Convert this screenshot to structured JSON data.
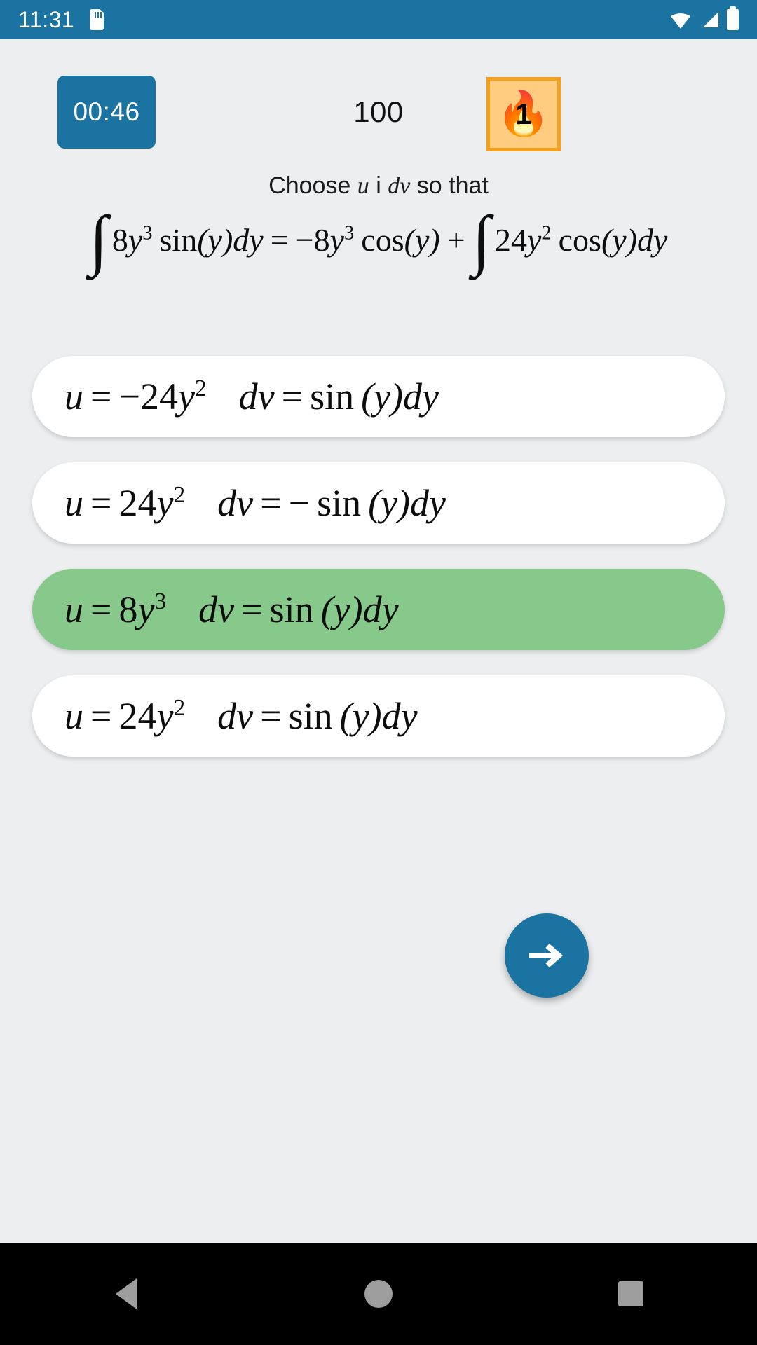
{
  "status_bar": {
    "time": "11:31",
    "icons": [
      "sd-card-icon",
      "wifi-icon",
      "cellular-signal-icon",
      "battery-icon"
    ],
    "background_color": "#1a73a0"
  },
  "header": {
    "timer": {
      "value": "00:46",
      "background_color": "#1a73a0",
      "text_color": "#ffffff"
    },
    "score": "100",
    "streak": {
      "count": "1",
      "icon": "flame-icon",
      "glyph": "🔥",
      "border_color": "#f5a11c",
      "fill_color": "#ffcc80"
    }
  },
  "question": {
    "prompt_prefix": "Choose ",
    "prompt_var_u": "u",
    "prompt_conj": " i ",
    "prompt_var_dv": "dv",
    "prompt_suffix": " so that",
    "equation": {
      "lhs_integrand_coef": "8",
      "lhs_var": "y",
      "lhs_exp": "3",
      "lhs_trig": "sin",
      "lhs_arg": "(y)",
      "lhs_diff": "dy",
      "equals": "=",
      "rhs_term_sign": "−",
      "rhs_term_coef": "8",
      "rhs_term_var": "y",
      "rhs_term_exp": "3",
      "rhs_trig": "cos",
      "rhs_arg": "(y)",
      "plus": "+",
      "rhs_int_coef": "24",
      "rhs_int_var": "y",
      "rhs_int_exp": "2",
      "rhs_int_trig": "cos",
      "rhs_int_arg": "(y)",
      "rhs_int_diff": "dy",
      "integral_symbol": "∫",
      "plain_text": "∫ 8y³ sin (y)dy = −8y³ cos (y) + ∫ 24y² cos (y)dy"
    }
  },
  "options": [
    {
      "id": "option-1",
      "u_label": "u",
      "u_equals": "=",
      "u_sign": "−",
      "u_coef": "24",
      "u_var": "y",
      "u_exp": "2",
      "dv_label": "dv",
      "dv_equals": "=",
      "dv_sign": "",
      "dv_trig": "sin",
      "dv_arg": "(y)",
      "dv_diff": "dy",
      "selected": false,
      "plain_text": "u = −24y²    dv = sin (y)dy"
    },
    {
      "id": "option-2",
      "u_label": "u",
      "u_equals": "=",
      "u_sign": "",
      "u_coef": "24",
      "u_var": "y",
      "u_exp": "2",
      "dv_label": "dv",
      "dv_equals": "=",
      "dv_sign": "−",
      "dv_trig": "sin",
      "dv_arg": "(y)",
      "dv_diff": "dy",
      "selected": false,
      "plain_text": "u = 24y²    dv = − sin (y)dy"
    },
    {
      "id": "option-3",
      "u_label": "u",
      "u_equals": "=",
      "u_sign": "",
      "u_coef": "8",
      "u_var": "y",
      "u_exp": "3",
      "dv_label": "dv",
      "dv_equals": "=",
      "dv_sign": "",
      "dv_trig": "sin",
      "dv_arg": "(y)",
      "dv_diff": "dy",
      "selected": true,
      "plain_text": "u = 8y³    dv = sin (y)dy"
    },
    {
      "id": "option-4",
      "u_label": "u",
      "u_equals": "=",
      "u_sign": "",
      "u_coef": "24",
      "u_var": "y",
      "u_exp": "2",
      "dv_label": "dv",
      "dv_equals": "=",
      "dv_sign": "",
      "dv_trig": "sin",
      "dv_arg": "(y)",
      "dv_diff": "dy",
      "selected": false,
      "plain_text": "u = 24y²    dv = sin (y)dy"
    }
  ],
  "next_button": {
    "icon": "arrow-right-icon",
    "background_color": "#1a73a0"
  },
  "nav_bar": {
    "back": "back-triangle-icon",
    "home": "home-circle-icon",
    "recents": "recents-square-icon"
  },
  "colors": {
    "page_background": "#eceef0",
    "accent_blue": "#1a73a0",
    "selected_green": "#86c98a",
    "card_white": "#ffffff",
    "streak_orange": "#f5a11c"
  }
}
